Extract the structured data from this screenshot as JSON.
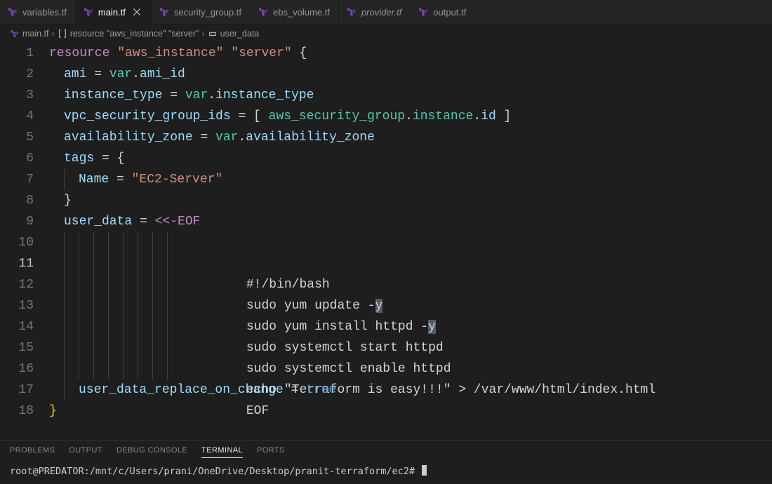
{
  "tabs": [
    {
      "label": "variables.tf",
      "active": false,
      "italic": false
    },
    {
      "label": "main.tf",
      "active": true,
      "italic": false
    },
    {
      "label": "security_group.tf",
      "active": false,
      "italic": false
    },
    {
      "label": "ebs_volume.tf",
      "active": false,
      "italic": false
    },
    {
      "label": "provider.tf",
      "active": false,
      "italic": true
    },
    {
      "label": "output.tf",
      "active": false,
      "italic": false
    }
  ],
  "breadcrumb": {
    "file": "main.tf",
    "segments": [
      {
        "icon": "symbol-namespace",
        "label": "resource \"aws_instance\" \"server\""
      },
      {
        "icon": "symbol-key",
        "label": "user_data"
      }
    ]
  },
  "editor": {
    "current_line": 11,
    "lines": {
      "kw_resource": "resource",
      "str_aws_instance": "\"aws_instance\"",
      "str_server": "\"server\"",
      "ami": "ami",
      "eq": " = ",
      "var": "var",
      "ami_id": "ami_id",
      "instance_type": "instance_type",
      "vpc_sg": "vpc_security_group_ids",
      "az": "availability_zone",
      "tags": "tags",
      "name": "Name",
      "ec2server": "\"EC2-Server\"",
      "user_data": "user_data",
      "heredoc": "<<-EOF",
      "bash1": "#!/bin/bash",
      "bash2a": "sudo yum update -",
      "bash2b": "y",
      "bash3a": "sudo yum install httpd -",
      "bash3b": "y",
      "bash4": "sudo systemctl start httpd",
      "bash5": "sudo systemctl enable httpd",
      "bash6": "echo \"Terraform is easy!!!\" > /var/www/html/index.html",
      "bash7": "EOF",
      "udroc": "user_data_replace_on_change",
      "true": "true",
      "aws_sg": "aws_security_group",
      "instance": "instance",
      "id": "id"
    }
  },
  "panel": {
    "tabs": [
      "PROBLEMS",
      "OUTPUT",
      "DEBUG CONSOLE",
      "TERMINAL",
      "PORTS"
    ],
    "active_tab": "TERMINAL",
    "terminal_prompt": "root@PREDATOR:/mnt/c/Users/prani/OneDrive/Desktop/pranit-terraform/ec2# "
  }
}
